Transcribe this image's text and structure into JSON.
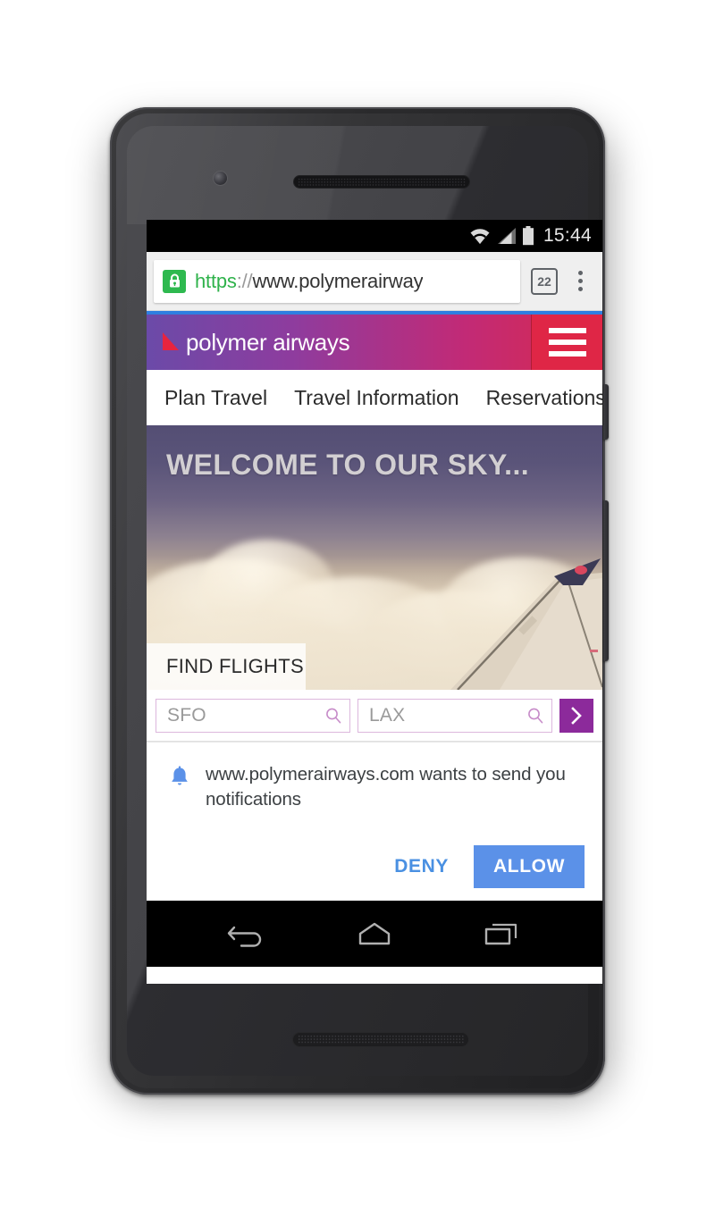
{
  "status_bar": {
    "wifi_icon": "wifi-icon",
    "signal_icon": "cellular-signal-icon",
    "battery_icon": "battery-icon",
    "clock": "15:44"
  },
  "browser": {
    "lock_icon": "lock-icon",
    "url_scheme": "https",
    "url_separator": "://",
    "url_host": "www.polymerairway",
    "tab_count": "22",
    "overflow_icon": "more-vertical-icon",
    "progress_color": "#2f7fe0"
  },
  "site": {
    "brand_name": "polymer airways",
    "brand_mark_icon": "airline-wing-logo-icon",
    "menu_icon": "hamburger-menu-icon",
    "header_gradient_start": "#6b4aa8",
    "header_gradient_end": "#d82a4c",
    "hamburger_panel_color": "#df2646",
    "nav_items": [
      {
        "label": "Plan Travel"
      },
      {
        "label": "Travel Information"
      },
      {
        "label": "Reservations"
      }
    ],
    "hero": {
      "title": "WELCOME TO OUR SKY...",
      "tab_label": "FIND FLIGHTS",
      "image_alt": "airplane-wing-above-clouds"
    },
    "search": {
      "origin_value": "SFO",
      "origin_placeholder": "SFO",
      "destination_value": "LAX",
      "destination_placeholder": "LAX",
      "origin_search_icon": "search-icon",
      "destination_search_icon": "search-icon",
      "submit_icon": "chevron-right-icon",
      "submit_color": "#8c2a9b",
      "field_border_color": "#dcb7dd"
    }
  },
  "permission_dialog": {
    "bell_icon": "notification-bell-icon",
    "message_origin": "www.polymerairways.com",
    "message_rest": " wants to send you notifications",
    "deny_label": "DENY",
    "allow_label": "ALLOW",
    "allow_color": "#5b91e8",
    "deny_color": "#4a90e2"
  },
  "android_navbar": {
    "back_icon": "back-arrow-icon",
    "home_icon": "home-icon",
    "recents_icon": "recent-apps-icon"
  },
  "device": {
    "front_camera_icon": "front-camera-icon",
    "earpiece_icon": "earpiece-speaker-icon",
    "bottom_speaker_icon": "bottom-speaker-icon",
    "power_button_icon": "power-button",
    "volume_button_icon": "volume-rocker-button"
  }
}
